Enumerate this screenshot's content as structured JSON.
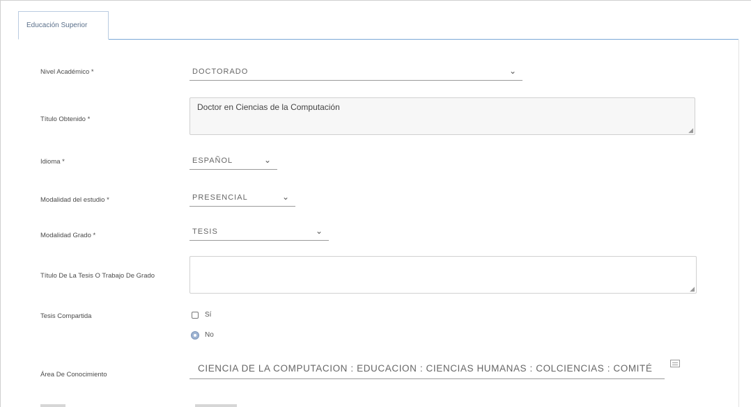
{
  "tabs": [
    {
      "label": "Educación Superior",
      "active": true
    }
  ],
  "form": {
    "nivel_academico": {
      "label": "Nivel Académico *",
      "value": "DOCTORADO"
    },
    "titulo_obtenido": {
      "label": "Título Obtenido *",
      "value": "Doctor en Ciencias de la Computación"
    },
    "idioma": {
      "label": "Idioma *",
      "value": "ESPAÑOL"
    },
    "modalidad_estudio": {
      "label": "Modalidad del estudio *",
      "value": "PRESENCIAL"
    },
    "modalidad_grado": {
      "label": "Modalidad Grado *",
      "value": "TESIS"
    },
    "titulo_tesis": {
      "label": "Título De La Tesis O Trabajo De Grado",
      "value": ""
    },
    "tesis_compartida": {
      "label": "Tesis Compartida",
      "options": [
        {
          "label": "Sí",
          "selected": false
        },
        {
          "label": "No",
          "selected": true
        }
      ]
    },
    "area_conocimiento": {
      "label": "Área De Conocimiento",
      "value": "CIENCIA DE LA COMPUTACION : EDUCACION : CIENCIAS HUMANAS : COLCIENCIAS : COMITÉ"
    }
  },
  "icons": {
    "chevron": "chevron-down-icon",
    "lookup": "list-lookup-icon",
    "resize": "resize-grip-icon"
  },
  "colors": {
    "tab_border": "#b9cbe0",
    "tab_underline": "#7aa7d6",
    "radio_selected": "#9fb4d2"
  }
}
